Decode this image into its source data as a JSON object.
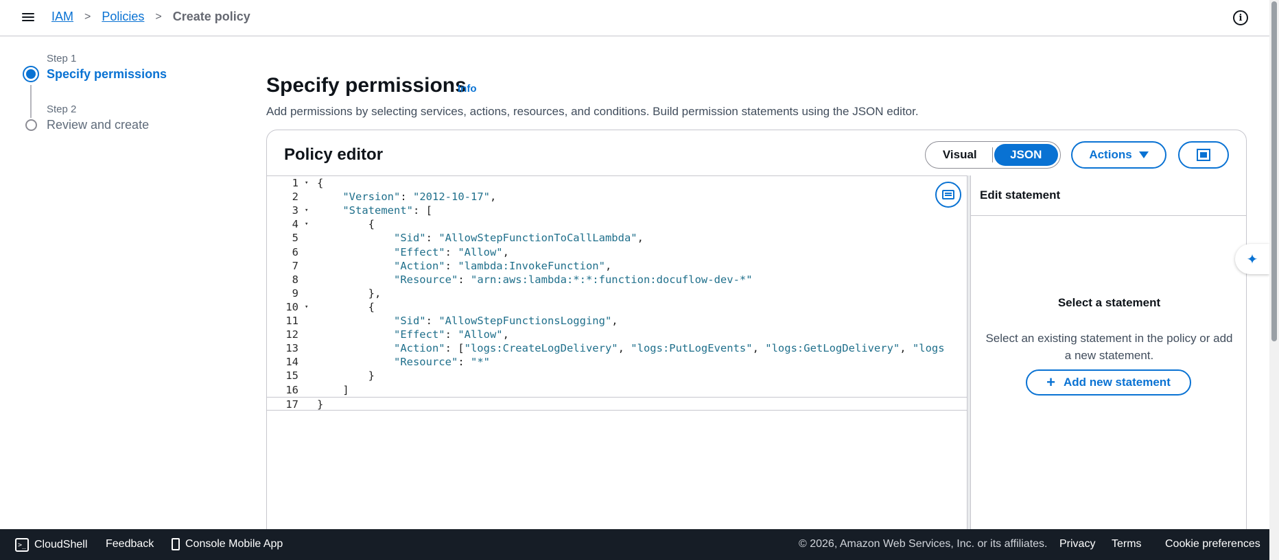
{
  "breadcrumb": {
    "items": [
      {
        "label": "IAM"
      },
      {
        "label": "Policies"
      }
    ],
    "current": "Create policy",
    "separator": ">"
  },
  "header_info_icon": "i",
  "stepper": {
    "steps": [
      {
        "step": "Step 1",
        "title": "Specify permissions"
      },
      {
        "step": "Step 2",
        "title": "Review and create"
      }
    ]
  },
  "page": {
    "title": "Specify permissions",
    "info_link": "Info",
    "description": "Add permissions by selecting services, actions, resources, and conditions. Build permission statements using the JSON editor."
  },
  "editor": {
    "title": "Policy editor",
    "modes": {
      "visual": "Visual",
      "json": "JSON"
    },
    "actions_label": "Actions",
    "lines": [
      {
        "n": "1",
        "fold": "▾",
        "text": "{"
      },
      {
        "n": "2",
        "fold": "",
        "text": "    \"Version\": \"2012-10-17\","
      },
      {
        "n": "3",
        "fold": "▾",
        "text": "    \"Statement\": ["
      },
      {
        "n": "4",
        "fold": "▾",
        "text": "        {"
      },
      {
        "n": "5",
        "fold": "",
        "text": "            \"Sid\": \"AllowStepFunctionToCallLambda\","
      },
      {
        "n": "6",
        "fold": "",
        "text": "            \"Effect\": \"Allow\","
      },
      {
        "n": "7",
        "fold": "",
        "text": "            \"Action\": \"lambda:InvokeFunction\","
      },
      {
        "n": "8",
        "fold": "",
        "text": "            \"Resource\": \"arn:aws:lambda:*:*:function:docuflow-dev-*\""
      },
      {
        "n": "9",
        "fold": "",
        "text": "        },"
      },
      {
        "n": "10",
        "fold": "▾",
        "text": "        {"
      },
      {
        "n": "11",
        "fold": "",
        "text": "            \"Sid\": \"AllowStepFunctionsLogging\","
      },
      {
        "n": "12",
        "fold": "",
        "text": "            \"Effect\": \"Allow\","
      },
      {
        "n": "13",
        "fold": "",
        "text": "            \"Action\": [\"logs:CreateLogDelivery\", \"logs:PutLogEvents\", \"logs:GetLogDelivery\", \"logs"
      },
      {
        "n": "14",
        "fold": "",
        "text": "            \"Resource\": \"*\""
      },
      {
        "n": "15",
        "fold": "",
        "text": "        }"
      },
      {
        "n": "16",
        "fold": "",
        "text": "    ]"
      },
      {
        "n": "17",
        "fold": "",
        "text": "}"
      }
    ]
  },
  "side_panel": {
    "title": "Edit statement",
    "empty_title": "Select a statement",
    "empty_desc": "Select an existing statement in the policy or add a new statement.",
    "add_button": "Add new statement",
    "add_icon": "+"
  },
  "footer": {
    "cloudshell": "CloudShell",
    "feedback": "Feedback",
    "mobile_app": "Console Mobile App",
    "copyright": "© 2026, Amazon Web Services, Inc. or its affiliates.",
    "privacy": "Privacy",
    "terms": "Terms",
    "cookie": "Cookie preferences"
  },
  "colors": {
    "accent": "#0972d3",
    "footer_bg": "#161d26",
    "string": "#1f6f8b"
  }
}
